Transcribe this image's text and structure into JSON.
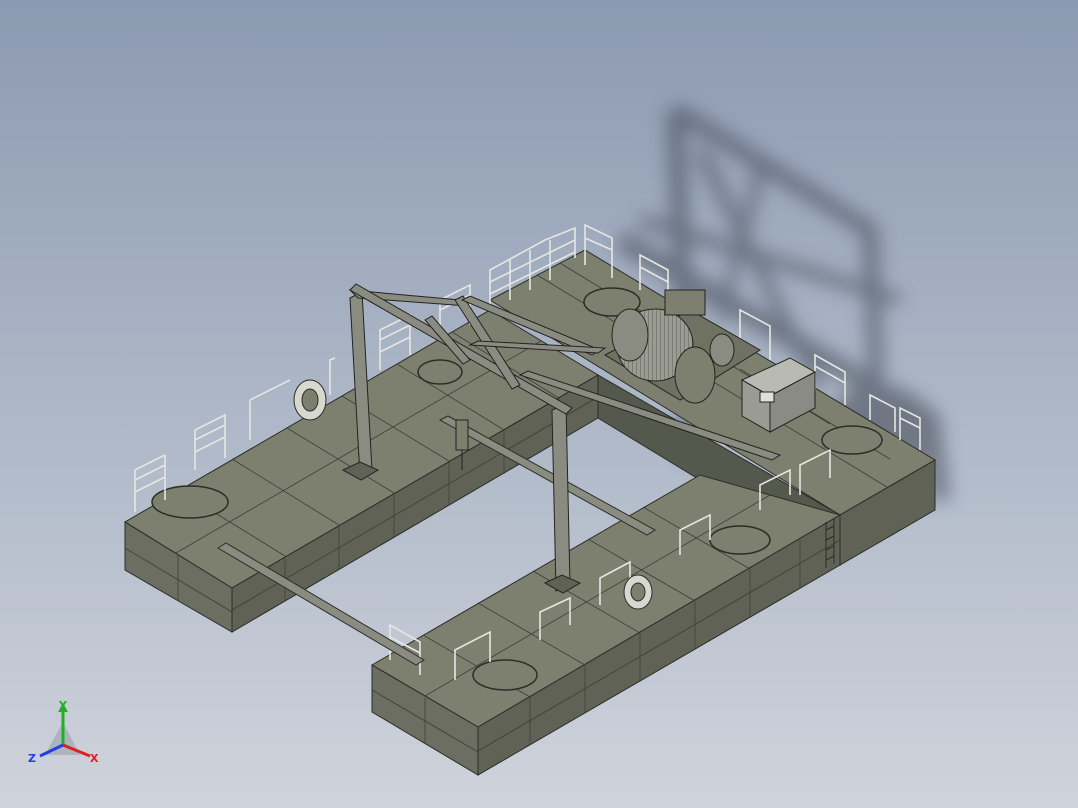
{
  "viewport": {
    "background_top": "#8c9ab1",
    "background_bottom": "#cfd3db",
    "model": "barge-with-gantry-and-winch"
  },
  "colors": {
    "hull_top": "#7b7e6d",
    "hull_side_dark": "#5d6052",
    "hull_side_light": "#6f7262",
    "steel": "#8a8c82",
    "edge": "#2b2d27",
    "shadow": "#4a5060"
  },
  "triad": {
    "x_label": "X",
    "y_label": "Y",
    "z_label": "Z",
    "x_color": "#e02020",
    "y_color": "#20b020",
    "z_color": "#2040e0"
  }
}
